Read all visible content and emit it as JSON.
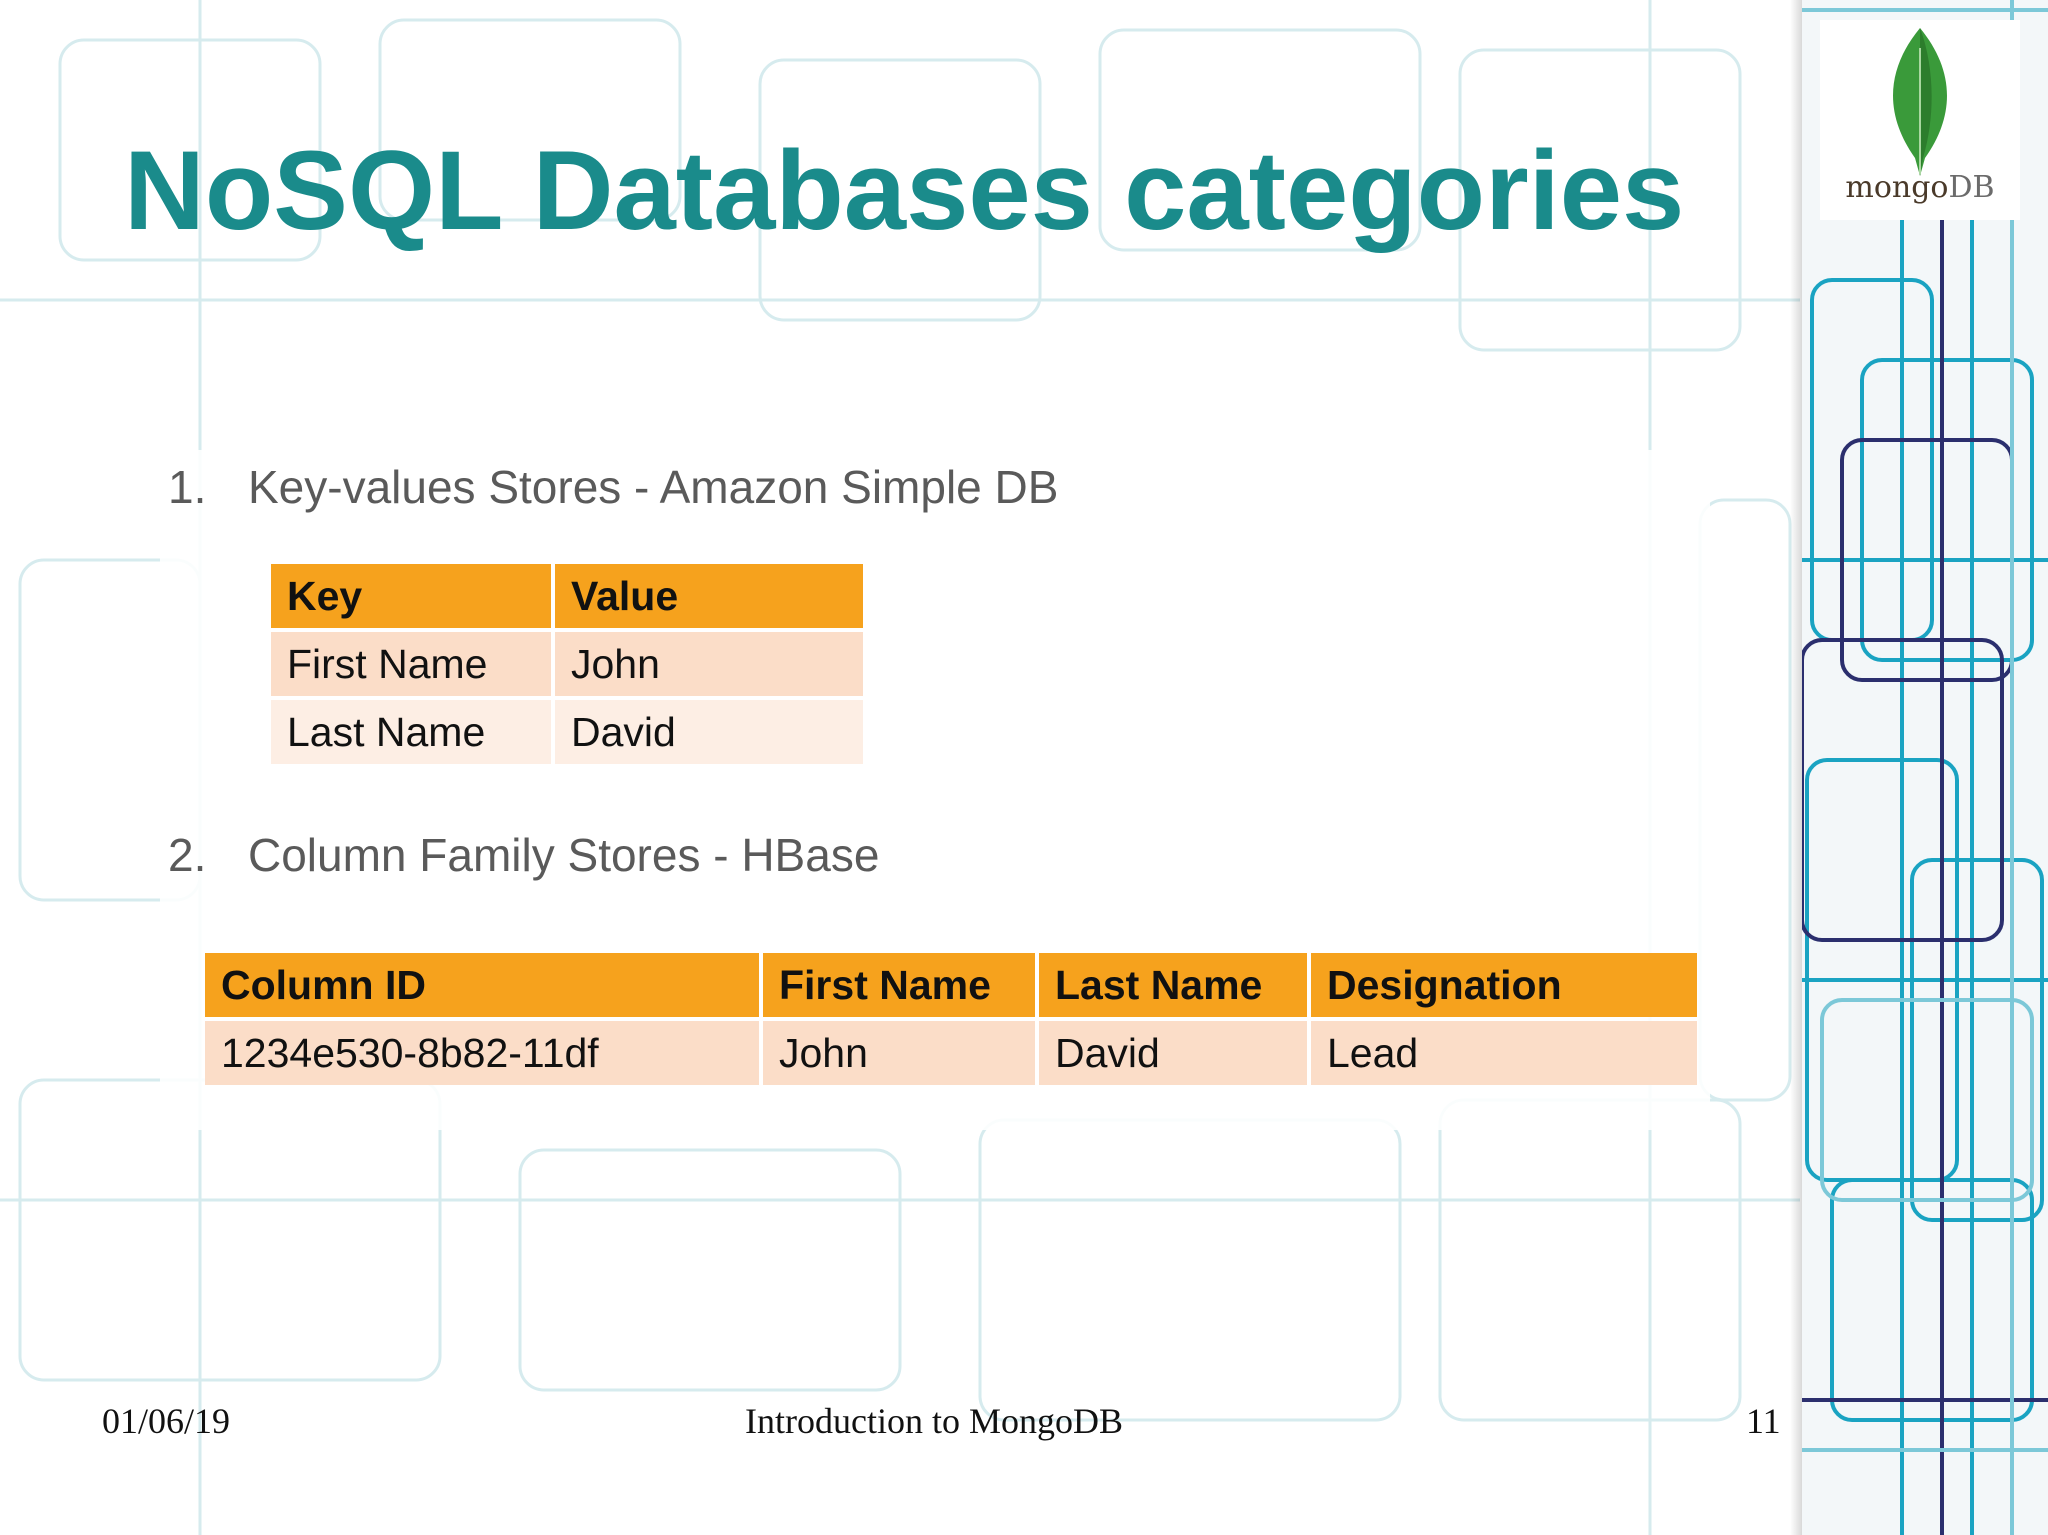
{
  "slide": {
    "title": "NoSQL Databases categories",
    "logo_text_prefix": "mongo",
    "logo_text_suffix": "DB"
  },
  "list": [
    {
      "number": "1.",
      "text": "Key-values Stores - Amazon Simple DB"
    },
    {
      "number": "2.",
      "text": "Column Family Stores - HBase"
    }
  ],
  "kv_table": {
    "headers": [
      "Key",
      "Value"
    ],
    "rows": [
      [
        "First Name",
        "John"
      ],
      [
        "Last Name",
        "David"
      ]
    ]
  },
  "column_table": {
    "headers": [
      "Column ID",
      "First Name",
      "Last Name",
      "Designation"
    ],
    "rows": [
      [
        "1234e530-8b82-11df",
        "John",
        "David",
        "Lead"
      ]
    ]
  },
  "footer": {
    "date": "01/06/19",
    "center": "Introduction to MongoDB",
    "page": "11"
  },
  "colors": {
    "title": "#1a8b8b",
    "table_header": "#f6a21d",
    "table_row_dark": "#fbddc8",
    "table_row_light": "#fdeee4",
    "leaf_green": "#3a9a3a"
  }
}
